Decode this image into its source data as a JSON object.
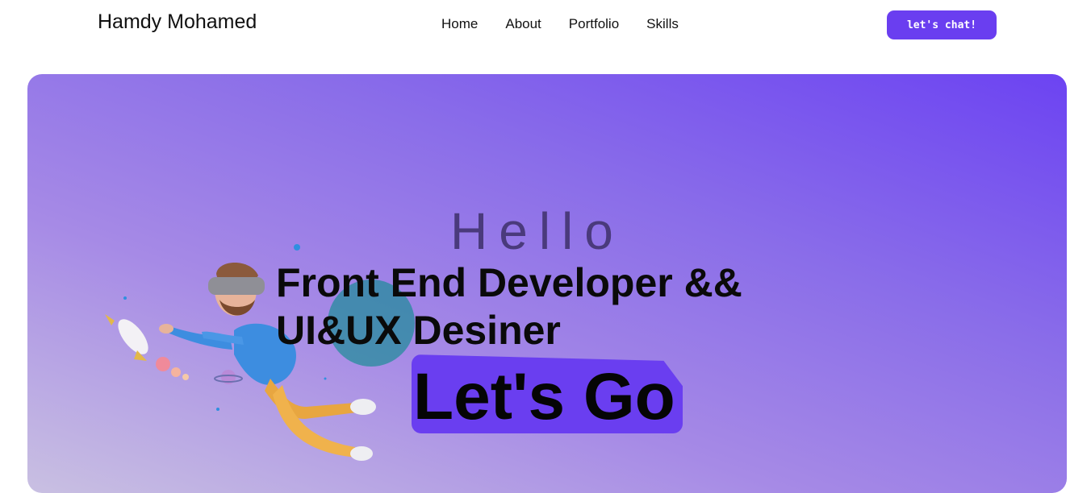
{
  "header": {
    "brand": "Hamdy Mohamed",
    "nav": [
      "Home",
      "About",
      "Portfolio",
      "Skills"
    ],
    "cta": "let's chat!"
  },
  "hero": {
    "greeting": "Hello",
    "role_line1": "Front End Developer &&",
    "role_line2": "UI&UX Desiner",
    "action": "Let's Go"
  },
  "colors": {
    "accent": "#6a3ef0",
    "hero_gradient_start": "#6c43f2",
    "hero_gradient_end": "#c9c0e2"
  },
  "illustration": {
    "icon": "vr-astronaut-rocket-illustration"
  }
}
